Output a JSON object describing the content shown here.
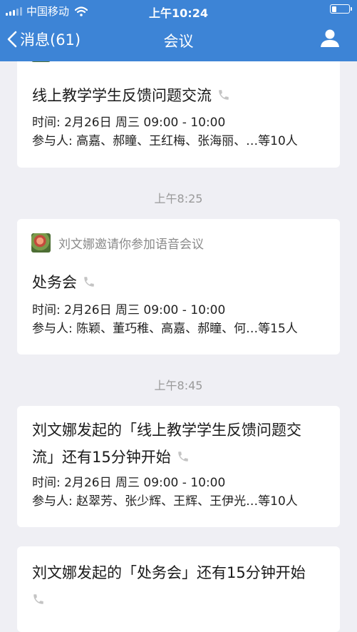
{
  "status_bar": {
    "carrier": "中国移动",
    "time": "上午10:24"
  },
  "nav": {
    "back_label": "消息(61)",
    "title": "会议"
  },
  "cards": [
    {
      "title": "线上教学学生反馈问题交流",
      "time_line": "时间: 2月26日 周三 09:00 - 10:00",
      "participants_line": "参与人: 高嘉、郝瞳、王红梅、张海丽、…等10人"
    },
    {
      "inviter": "刘文娜邀请你参加语音会议",
      "title": "处务会",
      "time_line": "时间: 2月26日 周三 09:00 - 10:00",
      "participants_line": "参与人: 陈颖、董巧稚、高嘉、郝瞳、何…等15人"
    },
    {
      "title_line1": "刘文娜发起的「线上教学学生反馈问题交",
      "title_line2": "流」还有15分钟开始",
      "time_line": "时间: 2月26日 周三 09:00 - 10:00",
      "participants_line": "参与人: 赵翠芳、张少辉、王辉、王伊光…等10人"
    },
    {
      "title": "刘文娜发起的「处务会」还有15分钟开始"
    }
  ],
  "timestamps": [
    "上午8:25",
    "上午8:45"
  ],
  "icons": {
    "back": "chevron-left-icon",
    "profile": "person-icon",
    "call": "phone-icon",
    "wifi": "wifi-icon",
    "battery": "battery-icon"
  },
  "colors": {
    "header": "#3d84d6",
    "background": "#efeff4",
    "card": "#ffffff",
    "muted": "#9a9a9a"
  }
}
